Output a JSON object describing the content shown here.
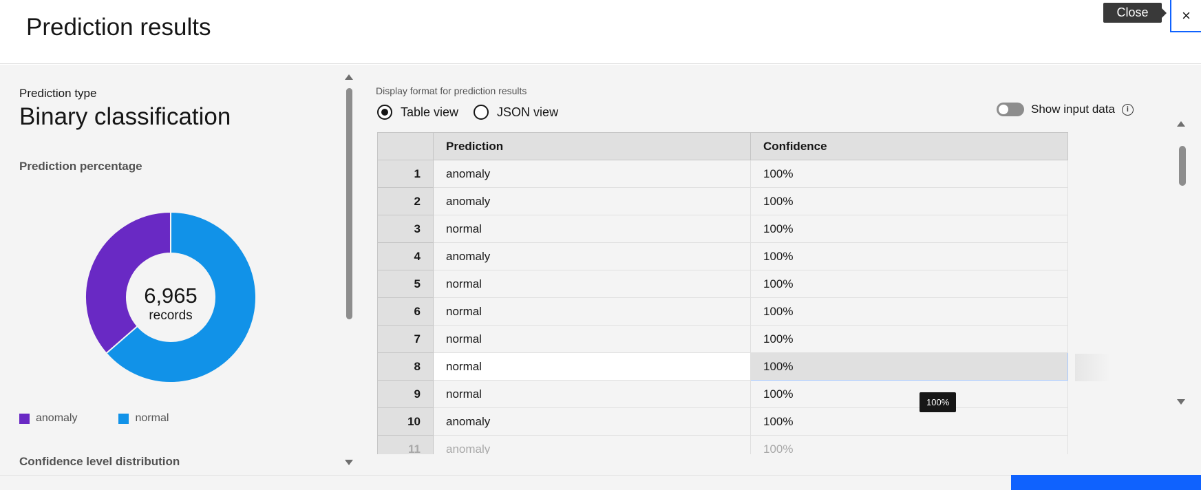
{
  "header": {
    "title": "Prediction results",
    "close_tooltip": "Close",
    "close_icon": "×"
  },
  "left": {
    "prediction_type_label": "Prediction type",
    "prediction_type_value": "Binary classification",
    "prediction_percentage_label": "Prediction percentage",
    "donut": {
      "total": "6,965",
      "unit": "records",
      "segments": [
        {
          "name": "anomaly",
          "fraction": 0.364,
          "color": "#6929c4"
        },
        {
          "name": "normal",
          "fraction": 0.636,
          "color": "#1192e8"
        }
      ]
    },
    "legend": [
      {
        "label": "anomaly",
        "color": "#6929c4"
      },
      {
        "label": "normal",
        "color": "#1192e8"
      }
    ],
    "confidence_label": "Confidence level distribution"
  },
  "right": {
    "display_format_label": "Display format for prediction results",
    "radio_table": "Table view",
    "radio_json": "JSON view",
    "selected_view": "Table view",
    "toggle_label": "Show input data",
    "toggle_on": false,
    "info_icon": "i",
    "columns": [
      "",
      "Prediction",
      "Confidence"
    ],
    "rows": [
      {
        "idx": "1",
        "prediction": "anomaly",
        "confidence": "100%"
      },
      {
        "idx": "2",
        "prediction": "anomaly",
        "confidence": "100%"
      },
      {
        "idx": "3",
        "prediction": "normal",
        "confidence": "100%"
      },
      {
        "idx": "4",
        "prediction": "anomaly",
        "confidence": "100%"
      },
      {
        "idx": "5",
        "prediction": "normal",
        "confidence": "100%"
      },
      {
        "idx": "6",
        "prediction": "normal",
        "confidence": "100%"
      },
      {
        "idx": "7",
        "prediction": "normal",
        "confidence": "100%"
      },
      {
        "idx": "8",
        "prediction": "normal",
        "confidence": "100%"
      },
      {
        "idx": "9",
        "prediction": "normal",
        "confidence": "100%"
      },
      {
        "idx": "10",
        "prediction": "anomaly",
        "confidence": "100%"
      },
      {
        "idx": "11",
        "prediction": "anomaly",
        "confidence": "100%"
      }
    ],
    "highlighted_row": "8",
    "cell_tooltip": "100%"
  }
}
